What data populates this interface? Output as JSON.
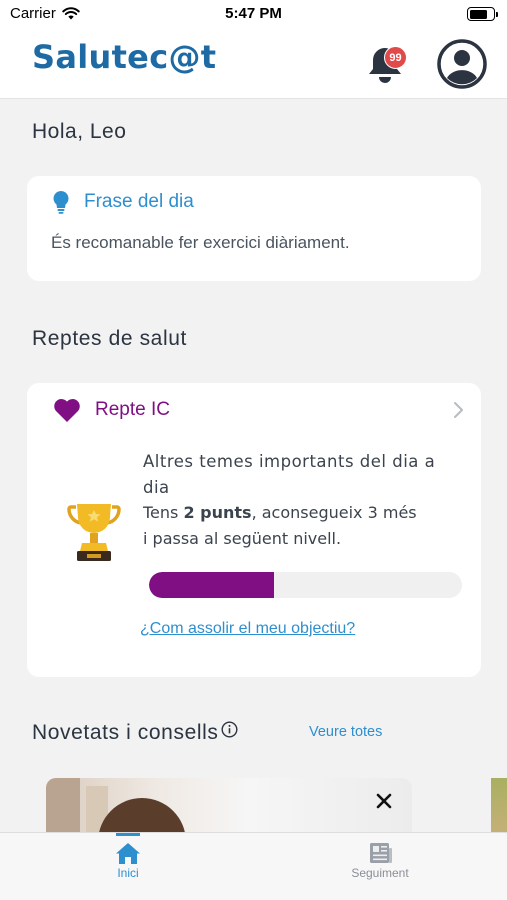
{
  "status_bar": {
    "carrier": "Carrier",
    "time": "5:47 PM"
  },
  "header": {
    "logo": "Salutec@t",
    "notifications_count": "99"
  },
  "greeting": "Hola, Leo",
  "phrase_card": {
    "title": "Frase del dia",
    "text": "És recomanable fer exercici diàriament."
  },
  "challenges": {
    "section_title": "Reptes de salut",
    "card": {
      "name": "Repte IC",
      "heading": "Altres temes importants del dia a dia",
      "points_prefix": "Tens",
      "points_value": "2 punts",
      "points_suffix": ", aconsegueix 3 més",
      "level_text": "i passa al següent nivell.",
      "progress_fraction": 0.4,
      "goal_link": "¿Com assolir el meu objectiu?"
    }
  },
  "news": {
    "section_title": "Novetats i consells",
    "see_all": "Veure totes"
  },
  "tabs": [
    {
      "label": "Inici",
      "active": true
    },
    {
      "label": "Seguiment",
      "active": false
    }
  ],
  "colors": {
    "brand": "#1d6aa5",
    "accent": "#2e8fcf",
    "challenge": "#7f0f83",
    "badge": "#e04a4a"
  }
}
